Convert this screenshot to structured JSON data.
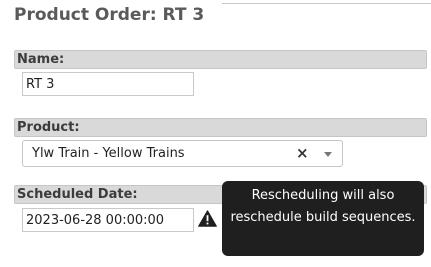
{
  "page": {
    "title": "Product Order: RT 3"
  },
  "fields": {
    "name": {
      "label": "Name:",
      "value": "RT 3"
    },
    "product": {
      "label": "Product:",
      "selected": "Ylw Train - Yellow Trains",
      "clear_symbol": "×"
    },
    "scheduled_date": {
      "label": "Scheduled Date:",
      "value": "2023-06-28 00:00:00"
    }
  },
  "tooltip": {
    "text": "Rescheduling will also reschedule build sequences."
  },
  "icons": {
    "clear": "close-icon",
    "dropdown": "chevron-down-icon",
    "warning": "warning-icon"
  },
  "colors": {
    "label_background": "#d9d9d9",
    "tooltip_background": "#1f1f1f",
    "title_text": "#5a5a5a"
  }
}
